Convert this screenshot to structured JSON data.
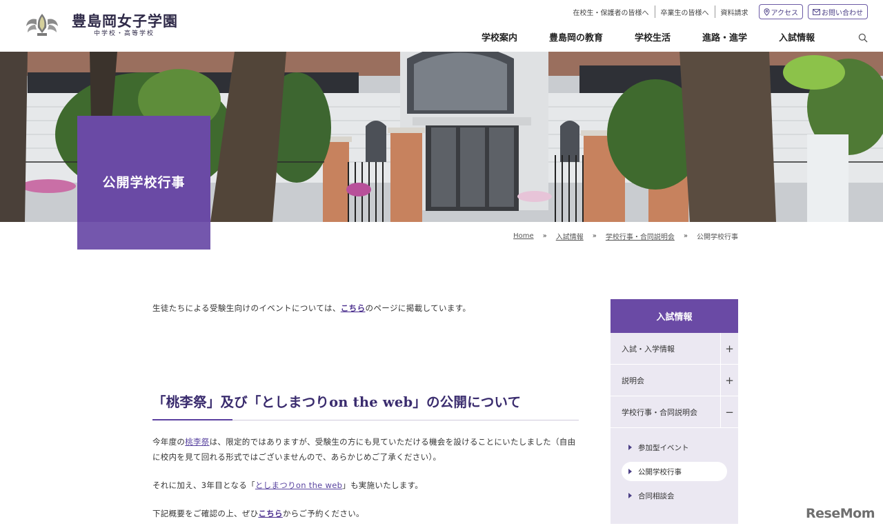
{
  "site": {
    "name": "豊島岡女子学園",
    "subtitle": "中学校・高等学校"
  },
  "utility_nav": {
    "links": [
      "在校生・保護者の皆様へ",
      "卒業生の皆様へ",
      "資料請求"
    ],
    "access_label": "アクセス",
    "contact_label": "お問い合わせ"
  },
  "main_nav": [
    "学校案内",
    "豊島岡の教育",
    "学校生活",
    "進路・進学",
    "入試情報"
  ],
  "page_title": "公開学校行事",
  "breadcrumb": {
    "items": [
      "Home",
      "入試情報",
      "学校行事・合同説明会"
    ],
    "current": "公開学校行事",
    "separator": "»"
  },
  "content": {
    "intro_before": "生徒たちによる受験生向けのイベントについては、",
    "intro_link": "こちら",
    "intro_after": "のページに掲載しています。",
    "heading": "「桃李祭」及び「としまつりon the web」の公開について",
    "p1_before": "今年度の",
    "p1_link": "桃李祭",
    "p1_after": "は、限定的ではありますが、受験生の方にも見ていただける機会を設けることにいたしました（自由に校内を見て回れる形式ではございませんので、あらかじめご了承ください）。",
    "p2_before": "それに加え、3年目となる「",
    "p2_link": "としまつりon the web",
    "p2_after": "」も実施いたします。",
    "p3_before": "下記概要をご確認の上、ぜひ",
    "p3_link": "こちら",
    "p3_after": "からご予約ください。"
  },
  "sidebar": {
    "heading": "入試情報",
    "items": [
      {
        "label": "入試・入学情報",
        "toggle": "+"
      },
      {
        "label": "説明会",
        "toggle": "+"
      },
      {
        "label": "学校行事・合同説明会",
        "toggle": "−"
      }
    ],
    "sub_items": [
      "参加型イベント",
      "公開学校行事",
      "合同相談会"
    ],
    "active_sub": "公開学校行事"
  },
  "watermark": "ReseMom",
  "colors": {
    "accent": "#6a4aa5",
    "accent_dark": "#4b2f8e",
    "sidebar_bg": "#ebe8f2"
  }
}
